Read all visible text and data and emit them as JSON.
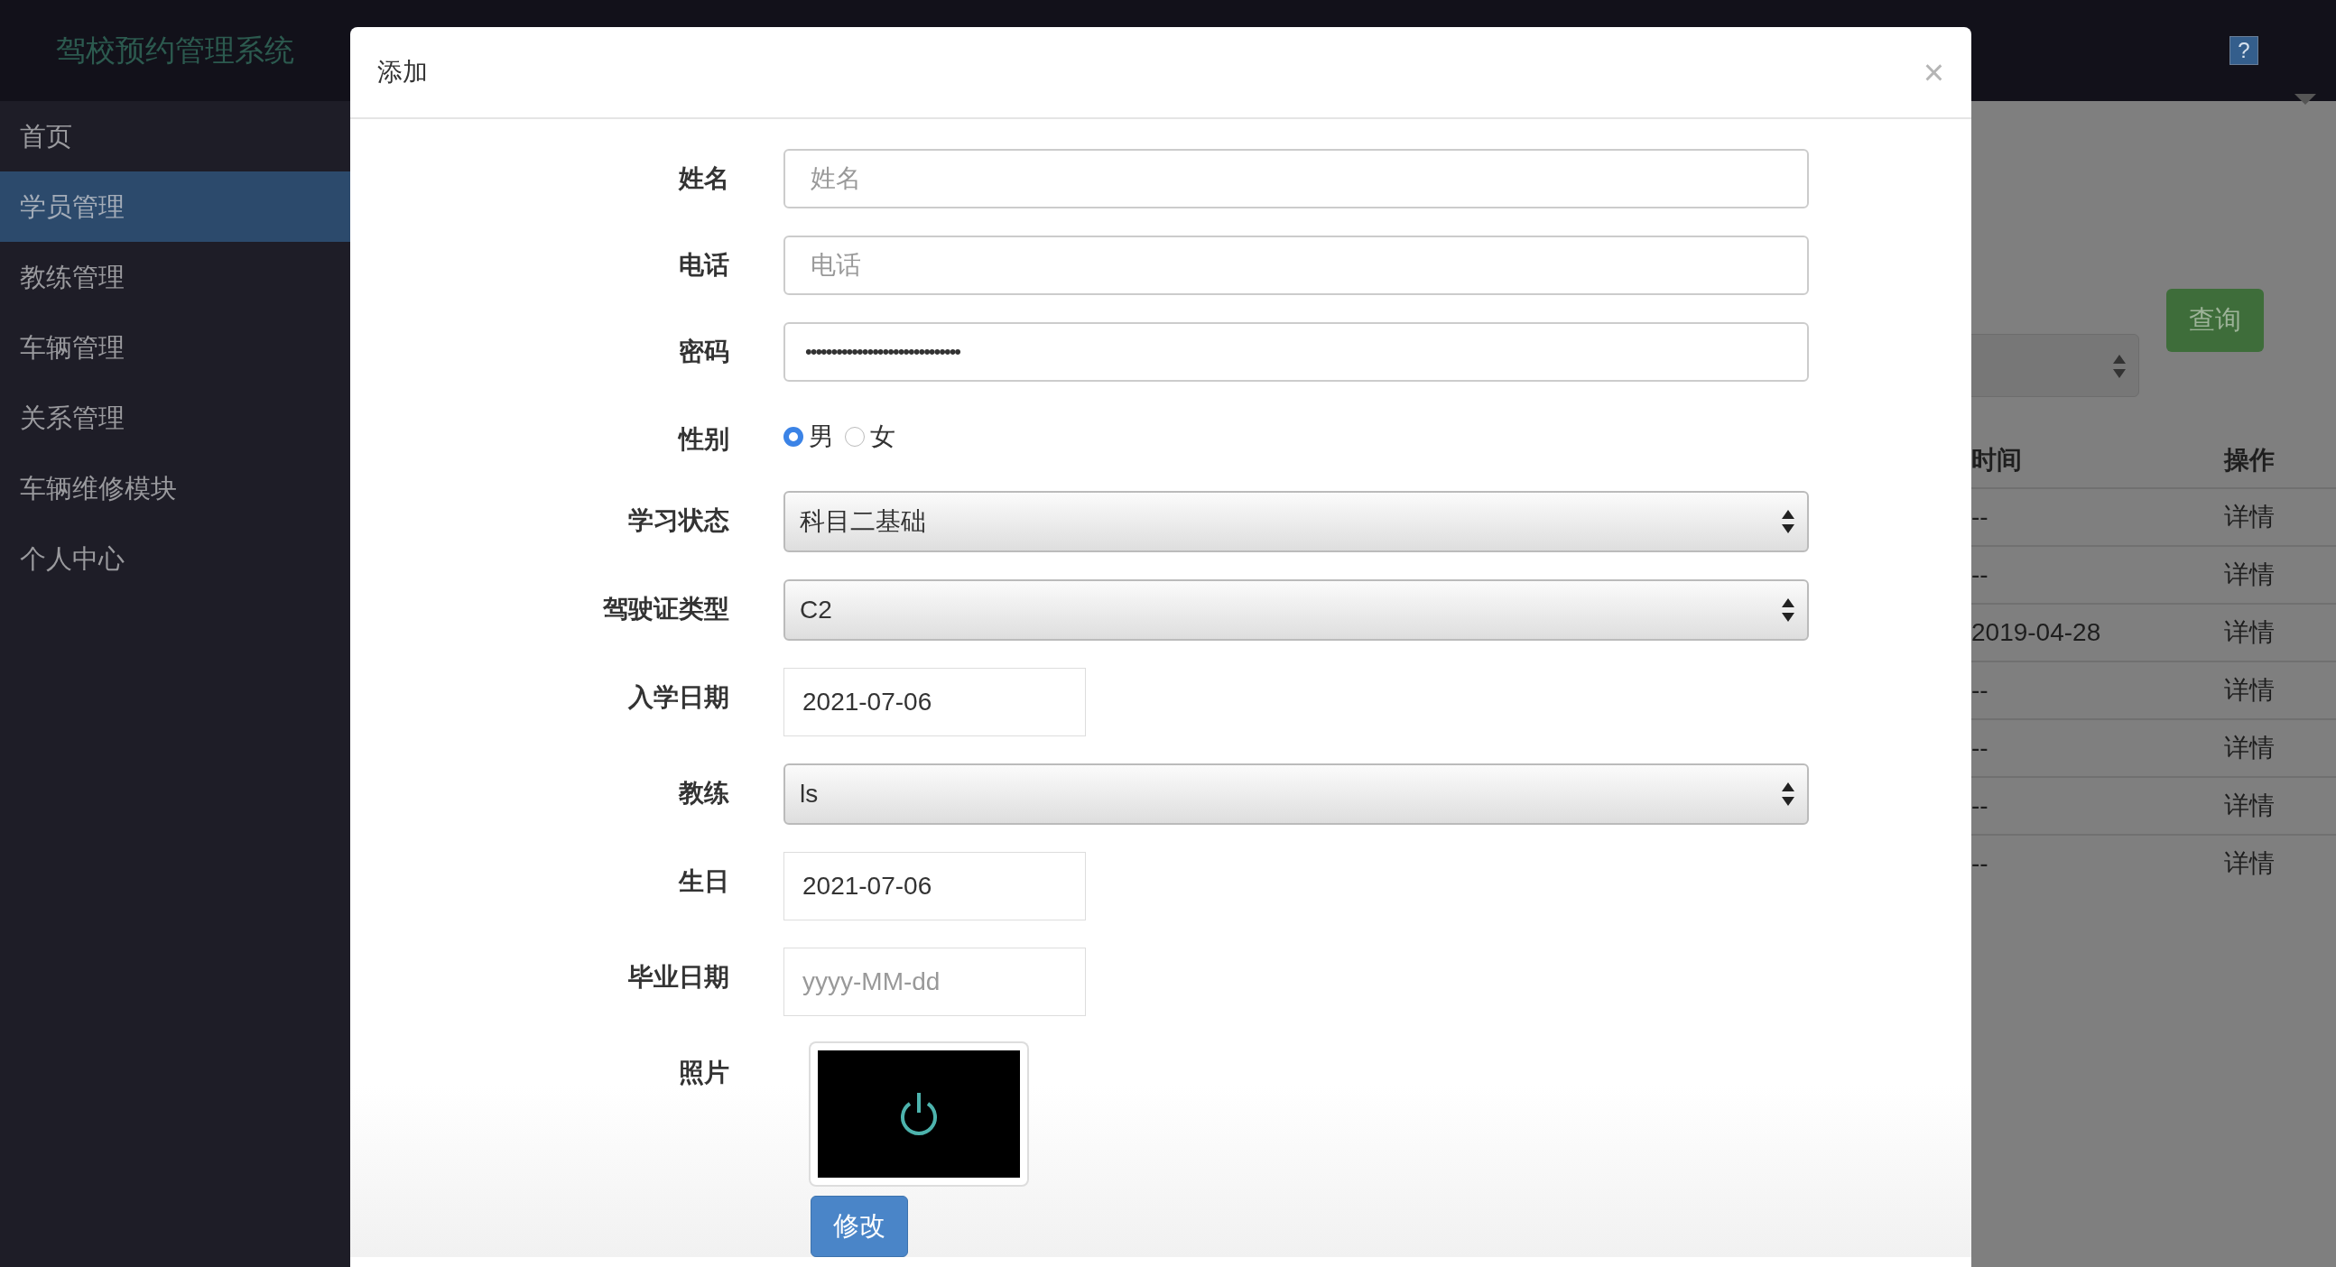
{
  "app_title": "驾校预约管理系统",
  "help": "?",
  "sidebar": {
    "items": [
      {
        "label": "首页",
        "selected": false
      },
      {
        "label": "学员管理",
        "selected": true
      },
      {
        "label": "教练管理",
        "selected": false
      },
      {
        "label": "车辆管理",
        "selected": false
      },
      {
        "label": "关系管理",
        "selected": false
      },
      {
        "label": "车辆维修模块",
        "selected": false
      },
      {
        "label": "个人中心",
        "selected": false
      }
    ]
  },
  "background": {
    "search_button": "查询",
    "table": {
      "columns": [
        "时间",
        "操作"
      ],
      "rows": [
        [
          "--",
          "详情"
        ],
        [
          "--",
          "详情"
        ],
        [
          "2019-04-28",
          "详情"
        ],
        [
          "--",
          "详情"
        ],
        [
          "--",
          "详情"
        ],
        [
          "--",
          "详情"
        ],
        [
          "--",
          "详情"
        ]
      ]
    }
  },
  "dialog": {
    "title": "添加",
    "close": "×",
    "fields": [
      {
        "kind": "text",
        "label": "姓名",
        "placeholder": "姓名"
      },
      {
        "kind": "text",
        "label": "电话",
        "placeholder": "电话"
      },
      {
        "kind": "password",
        "label": "密码",
        "value": "••••••••••••••••••••••••••••••"
      },
      {
        "kind": "radio",
        "label": "性别",
        "options": [
          {
            "label": "男",
            "selected": true
          },
          {
            "label": "女",
            "selected": false
          }
        ]
      },
      {
        "kind": "select",
        "label": "学习状态",
        "value": "科目二基础"
      },
      {
        "kind": "select",
        "label": "驾驶证类型",
        "value": "C2"
      },
      {
        "kind": "date",
        "label": "入学日期",
        "value": "2021-07-06"
      },
      {
        "kind": "select",
        "label": "教练",
        "value": "ls"
      },
      {
        "kind": "date",
        "label": "生日",
        "value": "2021-07-06"
      },
      {
        "kind": "date",
        "label": "毕业日期",
        "placeholder": "yyyy-MM-dd"
      },
      {
        "kind": "photo",
        "label": "照片",
        "button": "修改"
      }
    ]
  }
}
